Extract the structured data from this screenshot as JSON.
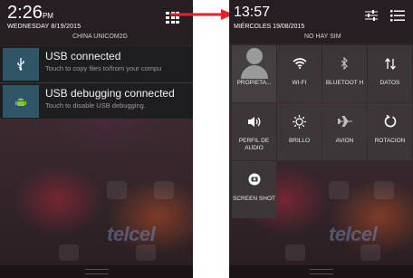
{
  "left": {
    "time": "2:26",
    "ampm": "PM",
    "date": "WEDNESDAY 8/19/2015",
    "carrier": "CHINA UNICOM2G",
    "notifications": [
      {
        "title": "USB connected",
        "subtitle": "Touch to copy files to/from your compu",
        "icon": "usb-icon"
      },
      {
        "title": "USB debugging connected",
        "subtitle": "Touch to disable USB debugging.",
        "icon": "android-icon"
      }
    ],
    "wallpaper_brand": "telcel"
  },
  "right": {
    "time": "13:57",
    "date": "MIÉRCOLES 19/08/2015",
    "carrier": "NO HAY SIM",
    "tiles": [
      {
        "label": "PROPIETA...",
        "icon": "profile-avatar"
      },
      {
        "label": "WI-FI",
        "icon": "wifi-icon"
      },
      {
        "label": "BLUETOOT H",
        "icon": "bluetooth-icon"
      },
      {
        "label": "DATOS",
        "icon": "data-icon"
      },
      {
        "label": "PERFIL DE AUDIO",
        "icon": "volume-icon"
      },
      {
        "label": "BRILLO",
        "icon": "brightness-icon"
      },
      {
        "label": "AVION",
        "icon": "airplane-icon"
      },
      {
        "label": "ROTACION",
        "icon": "rotate-icon"
      },
      {
        "label": "SCREEN SHOT",
        "icon": "screenshot-icon"
      }
    ],
    "wallpaper_brand": "telcel"
  },
  "colors": {
    "arrow": "#e8202a",
    "usb_tile": "#2f5566",
    "android_green": "#8bc34a"
  }
}
